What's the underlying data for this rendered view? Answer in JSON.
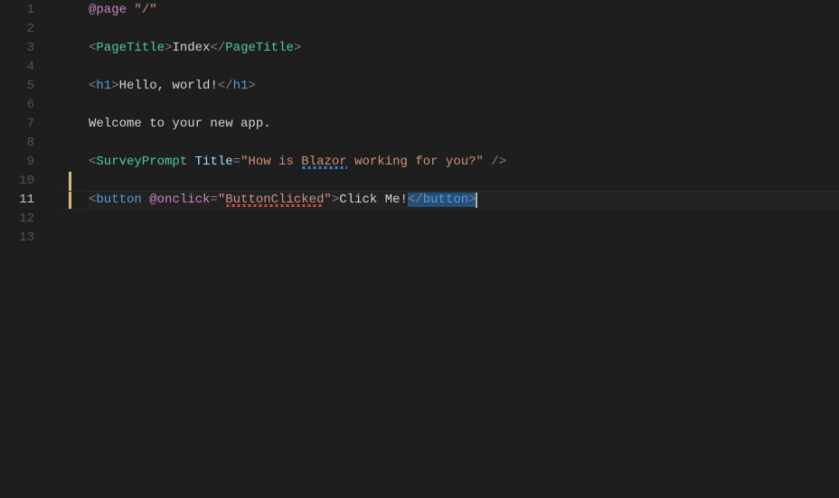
{
  "editor": {
    "lineNumbers": [
      "1",
      "2",
      "3",
      "4",
      "5",
      "6",
      "7",
      "8",
      "9",
      "10",
      "11",
      "12",
      "13"
    ],
    "activeLine": 11,
    "lines": {
      "l1": {
        "dir": "@page",
        "space": " ",
        "str": "\"/\""
      },
      "l3": {
        "lt1": "<",
        "tag1": "PageTitle",
        "gt1": ">",
        "text": "Index",
        "lt2": "</",
        "tag2": "PageTitle",
        "gt2": ">"
      },
      "l5": {
        "lt1": "<",
        "tag1": "h1",
        "gt1": ">",
        "text": "Hello, world!",
        "lt2": "</",
        "tag2": "h1",
        "gt2": ">"
      },
      "l7": {
        "text": "Welcome to your new app."
      },
      "l9": {
        "lt": "<",
        "tag": "SurveyPrompt",
        "sp1": " ",
        "attr": "Title",
        "eq": "=",
        "strA": "\"How is ",
        "strB": "Blazor",
        "strC": " working for you?\"",
        "close": " />"
      },
      "l11": {
        "lt1": "<",
        "tag1": "button",
        "sp1": " ",
        "dir": "@onclick",
        "eq": "=",
        "strA": "\"",
        "strB": "ButtonClicked",
        "strC": "\"",
        "gt1": ">",
        "text": "Click Me!",
        "lt2": "</",
        "tag2": "button",
        "gt2": ">"
      }
    }
  }
}
